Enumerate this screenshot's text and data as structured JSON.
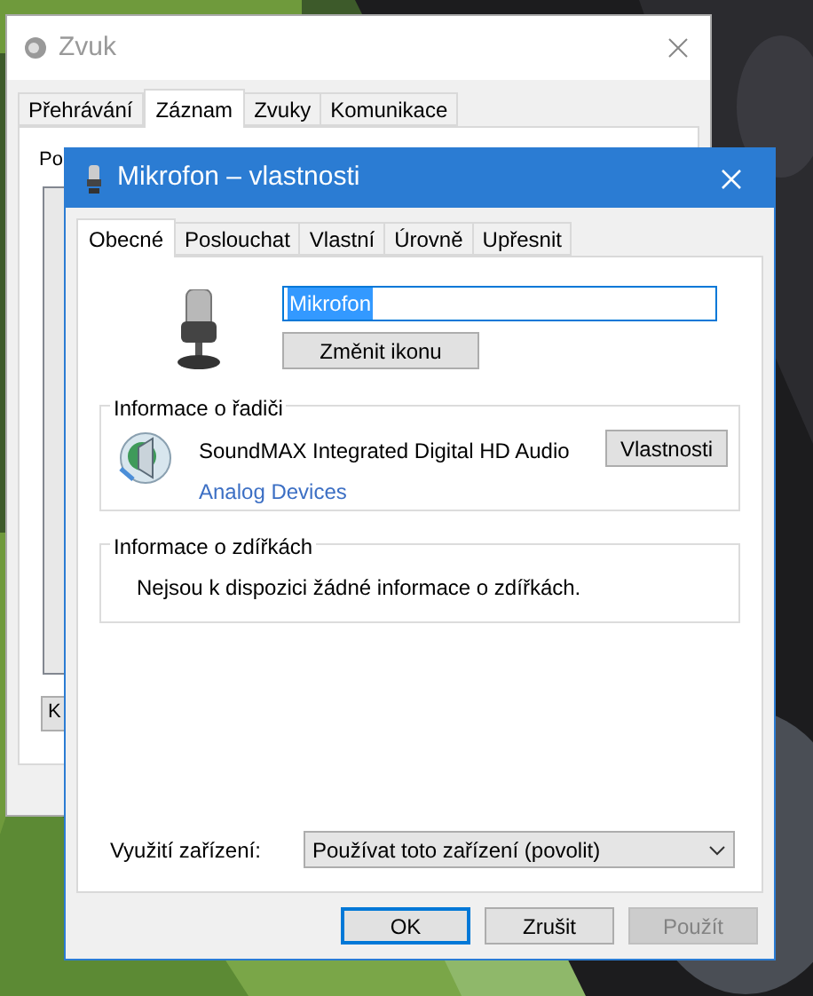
{
  "background_window": {
    "title": "Zvuk",
    "tabs": [
      {
        "label": "Přehrávání",
        "selected": false
      },
      {
        "label": "Záznam",
        "selected": true
      },
      {
        "label": "Zvuky",
        "selected": false
      },
      {
        "label": "Komunikace",
        "selected": false
      }
    ],
    "text": "Po",
    "button": "K"
  },
  "dialog": {
    "title": "Mikrofon – vlastnosti",
    "tabs": [
      {
        "label": "Obecné",
        "selected": true
      },
      {
        "label": "Poslouchat",
        "selected": false
      },
      {
        "label": "Vlastní",
        "selected": false
      },
      {
        "label": "Úrovně",
        "selected": false
      },
      {
        "label": "Upřesnit",
        "selected": false
      }
    ],
    "name_field": {
      "value": "Mikrofon",
      "value_selected": true
    },
    "change_icon_button": "Změnit ikonu",
    "controller_group": {
      "title": "Informace o řadiči",
      "device": "SoundMAX Integrated Digital HD Audio",
      "manufacturer": "Analog Devices",
      "button": "Vlastnosti"
    },
    "jack_group": {
      "title": "Informace o zdířkách",
      "message": "Nejsou k dispozici žádné informace o zdířkách."
    },
    "usage": {
      "label": "Využití zařízení:",
      "value": "Používat toto zařízení (povolit)"
    },
    "buttons": [
      {
        "label": "OK",
        "default": true,
        "disabled": false
      },
      {
        "label": "Zrušit",
        "default": false,
        "disabled": false
      },
      {
        "label": "Použít",
        "default": false,
        "disabled": true
      }
    ]
  }
}
